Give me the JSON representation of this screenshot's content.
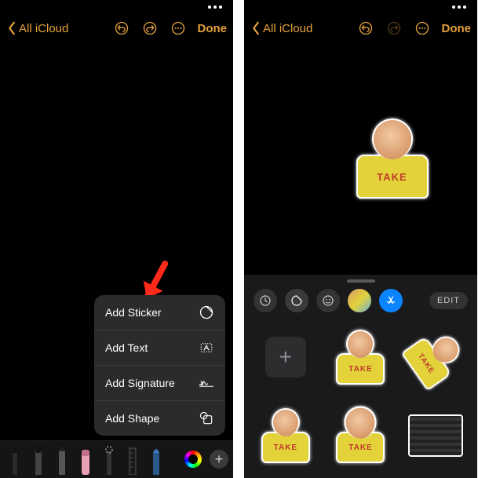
{
  "colors": {
    "accent": "#e6a23c",
    "arrow": "#ff2a1a",
    "appstore_blue": "#0a84ff"
  },
  "nav": {
    "back_label": "All iCloud",
    "done_label": "Done"
  },
  "popup": {
    "items": [
      {
        "label": "Add Sticker",
        "icon": "sticker-icon"
      },
      {
        "label": "Add Text",
        "icon": "textbox-icon"
      },
      {
        "label": "Add Signature",
        "icon": "signature-icon"
      },
      {
        "label": "Add Shape",
        "icon": "shape-icon"
      }
    ]
  },
  "toolbar": {
    "tools": [
      "pen",
      "marker",
      "pencil",
      "eraser",
      "lasso",
      "ruler",
      "paint"
    ],
    "plus_label": "+"
  },
  "drawer": {
    "tabs": [
      {
        "name": "recents-icon",
        "active": false
      },
      {
        "name": "sticker-icon",
        "active": true
      },
      {
        "name": "emoji-icon",
        "active": false
      },
      {
        "name": "photos-icon",
        "active": false
      },
      {
        "name": "appstore-icon",
        "active": false
      }
    ],
    "edit_label": "EDIT",
    "add_label": "+",
    "sticker_text": "TAKE"
  }
}
